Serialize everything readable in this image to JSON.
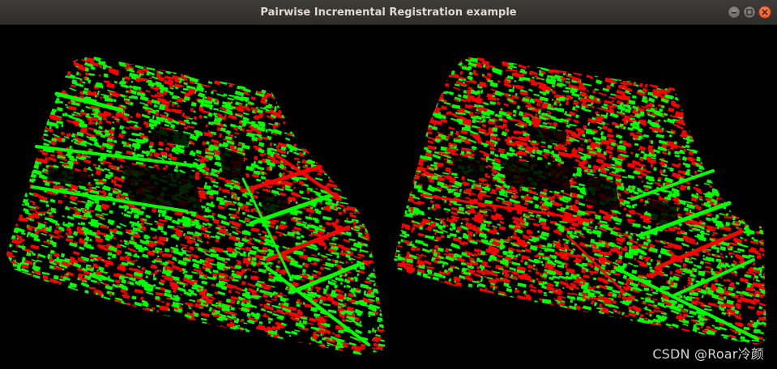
{
  "window": {
    "title": "Pairwise Incremental Registration example",
    "controls": [
      {
        "name": "minimize",
        "icon": "minimize-icon"
      },
      {
        "name": "maximize",
        "icon": "maximize-icon"
      },
      {
        "name": "close",
        "icon": "close-icon"
      }
    ]
  },
  "viewport": {
    "background": "#000000",
    "views": [
      {
        "name": "left-view",
        "source_color": "#ff0000",
        "target_color": "#00ff00"
      },
      {
        "name": "right-view",
        "source_color": "#ff0000",
        "target_color": "#00ff00"
      }
    ]
  },
  "watermark": {
    "text": "CSDN @Roar冷颜"
  }
}
